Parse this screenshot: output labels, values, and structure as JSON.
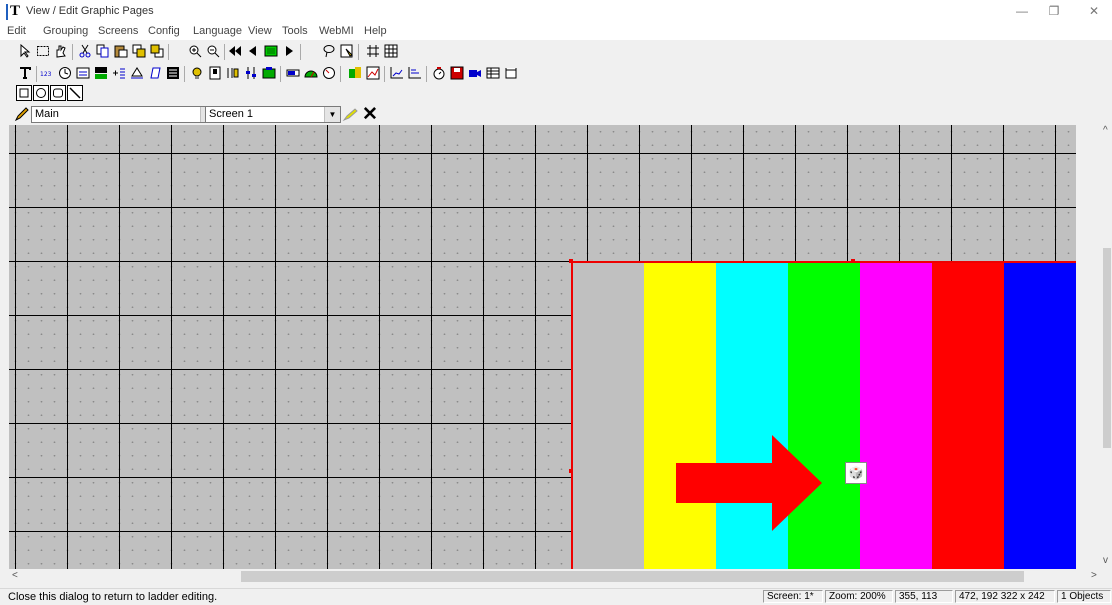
{
  "window": {
    "title": "View / Edit Graphic Pages",
    "app_icon_glyph": "T",
    "controls": {
      "minimize": "—",
      "restore": "❐",
      "close": "✕"
    }
  },
  "menu": [
    "Edit",
    "Grouping",
    "Screens",
    "Config",
    "Language",
    "View",
    "Tools",
    "WebMI",
    "Help"
  ],
  "selectors": {
    "group": "Main",
    "screen": "Screen 1",
    "close_glyph": "✕"
  },
  "canvas": {
    "background": "#c0c0c0",
    "color_bars": [
      "#c0c0c0",
      "#ffff00",
      "#00ffff",
      "#00ff00",
      "#ff00ff",
      "#ff0000",
      "#0000ff"
    ],
    "arrow_color": "#ff0000",
    "object_icon": "graphic-object-icon"
  },
  "statusbar": {
    "message": "Close this dialog to return to ladder editing.",
    "screen": "Screen: 1*",
    "zoom": "Zoom: 200%",
    "cursor": "355, 113",
    "selection": "472, 192  322 x 242",
    "objects": "1 Objects"
  }
}
